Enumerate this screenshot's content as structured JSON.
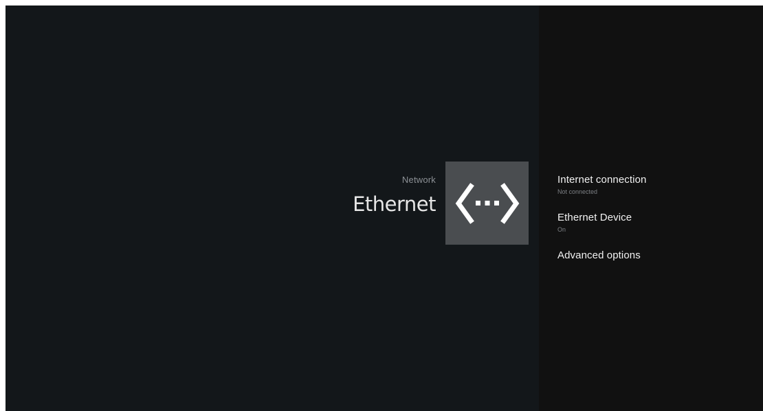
{
  "header": {
    "breadcrumb": "Network",
    "title": "Ethernet"
  },
  "hero_icon": "ethernet-icon",
  "menu": {
    "items": [
      {
        "title": "Internet connection",
        "subtitle": "Not connected"
      },
      {
        "title": "Ethernet Device",
        "subtitle": "On"
      },
      {
        "title": "Advanced options",
        "subtitle": ""
      }
    ]
  },
  "colors": {
    "left_background": "#13171a",
    "right_background": "#111111",
    "icon_tile": "#4a4d50",
    "primary_text": "#f2f2f2",
    "secondary_text": "#7d8085"
  }
}
